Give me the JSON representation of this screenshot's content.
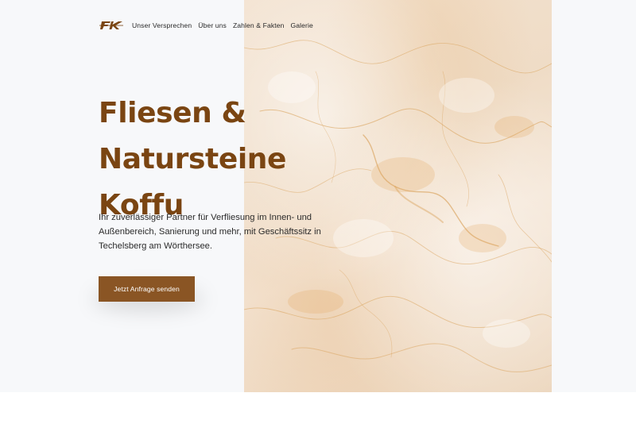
{
  "brand": {
    "logo_text": "FK",
    "color": "#7a4512"
  },
  "nav": {
    "items": [
      {
        "label": "Unser Versprechen"
      },
      {
        "label": "Über uns"
      },
      {
        "label": "Zahlen & Fakten"
      },
      {
        "label": "Galerie"
      }
    ]
  },
  "hero": {
    "headline_lines": [
      "Fliesen &",
      "Natursteine",
      "Koffu"
    ],
    "lead": "Ihr zuverlässiger Partner für Verfliesung im Innen- und Außenbereich, Sanierung und mehr, mit Geschäftssitz in Techelsberg am Wörthersee.",
    "cta_label": "Jetzt Anfrage senden",
    "image": "marble-stone-texture"
  },
  "colors": {
    "accent": "#7a4512",
    "button": "#8a5524",
    "background": "#f7f8fa"
  }
}
